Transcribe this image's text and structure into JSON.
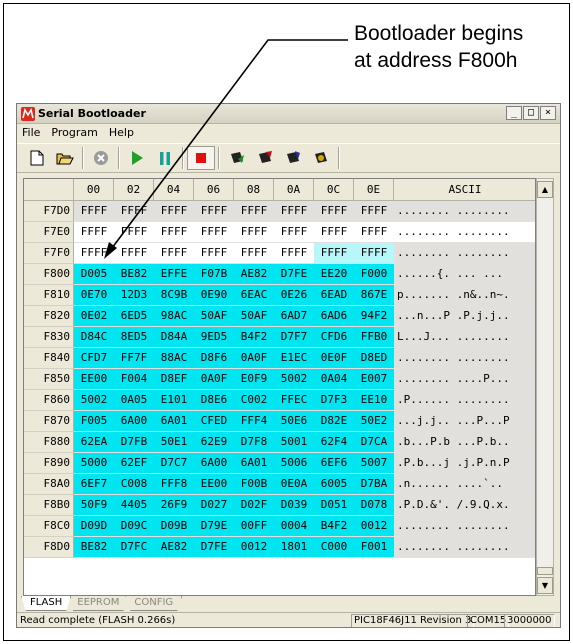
{
  "callout": {
    "line1": "Bootloader begins",
    "line2": "at address F800h"
  },
  "window": {
    "title": "Serial Bootloader",
    "buttons": {
      "minimize": "_",
      "maximize": "□",
      "close": "×"
    }
  },
  "menu": [
    "File",
    "Program",
    "Help"
  ],
  "toolbar": [
    {
      "icon": "new-file-icon",
      "color": "#ffffff"
    },
    {
      "icon": "open-folder-icon",
      "color": "#e8c14a"
    },
    {
      "icon": "abort-icon",
      "color": "#9a9a9a"
    },
    {
      "icon": "run-icon",
      "color": "#1ea02a"
    },
    {
      "icon": "pause-icon",
      "color": "#1a9e9a"
    },
    {
      "icon": "stop-icon",
      "color": "#e01010"
    },
    {
      "icon": "write-chip-icon",
      "color": "#1a8a2a"
    },
    {
      "icon": "read-chip-icon",
      "color": "#c01010"
    },
    {
      "icon": "erase-chip-icon",
      "color": "#2233aa"
    },
    {
      "icon": "verify-chip-icon",
      "color": "#d4aa00"
    }
  ],
  "grid": {
    "headers": [
      "00",
      "02",
      "04",
      "06",
      "08",
      "0A",
      "0C",
      "0E",
      "ASCII"
    ],
    "rows": [
      {
        "addr": "F7D0",
        "cells": [
          "FFFF",
          "FFFF",
          "FFFF",
          "FFFF",
          "FFFF",
          "FFFF",
          "FFFF",
          "FFFF"
        ],
        "ascii": "........ ........",
        "style": "gray"
      },
      {
        "addr": "F7E0",
        "cells": [
          "FFFF",
          "FFFF",
          "FFFF",
          "FFFF",
          "FFFF",
          "FFFF",
          "FFFF",
          "FFFF"
        ],
        "ascii": "........ ........",
        "style": "white"
      },
      {
        "addr": "F7F0",
        "cells": [
          "FFFF",
          "FFFF",
          "FFFF",
          "FFFF",
          "FFFF",
          "FFFF",
          "FFFF",
          "FFFF"
        ],
        "ascii": "........ ........",
        "style": "f7f0"
      },
      {
        "addr": "F800",
        "cells": [
          "D005",
          "BE82",
          "EFFE",
          "F07B",
          "AE82",
          "D7FE",
          "EE20",
          "F000"
        ],
        "ascii": "......{. ... ...",
        "style": "cyan"
      },
      {
        "addr": "F810",
        "cells": [
          "0E70",
          "12D3",
          "8C9B",
          "0E90",
          "6EAC",
          "0E26",
          "6EAD",
          "867E"
        ],
        "ascii": "p....... .n&..n~.",
        "style": "cyan"
      },
      {
        "addr": "F820",
        "cells": [
          "0E02",
          "6ED5",
          "98AC",
          "50AF",
          "50AF",
          "6AD7",
          "6AD6",
          "94F2"
        ],
        "ascii": "...n...P .P.j.j..",
        "style": "cyan"
      },
      {
        "addr": "F830",
        "cells": [
          "D84C",
          "8ED5",
          "D84A",
          "9ED5",
          "B4F2",
          "D7F7",
          "CFD6",
          "FFB0"
        ],
        "ascii": "L...J... ........",
        "style": "cyan"
      },
      {
        "addr": "F840",
        "cells": [
          "CFD7",
          "FF7F",
          "88AC",
          "D8F6",
          "0A0F",
          "E1EC",
          "0E0F",
          "D8ED"
        ],
        "ascii": "........ ........",
        "style": "cyan"
      },
      {
        "addr": "F850",
        "cells": [
          "EE00",
          "F004",
          "D8EF",
          "0A0F",
          "E0F9",
          "5002",
          "0A04",
          "E007"
        ],
        "ascii": "........ ....P...",
        "style": "cyan"
      },
      {
        "addr": "F860",
        "cells": [
          "5002",
          "0A05",
          "E101",
          "D8E6",
          "C002",
          "FFEC",
          "D7F3",
          "EE10"
        ],
        "ascii": ".P...... ........",
        "style": "cyan"
      },
      {
        "addr": "F870",
        "cells": [
          "F005",
          "6A00",
          "6A01",
          "CFED",
          "FFF4",
          "50E6",
          "D82E",
          "50E2"
        ],
        "ascii": "...j.j.. ...P...P",
        "style": "cyan"
      },
      {
        "addr": "F880",
        "cells": [
          "62EA",
          "D7FB",
          "50E1",
          "62E9",
          "D7F8",
          "5001",
          "62F4",
          "D7CA"
        ],
        "ascii": ".b...P.b ...P.b..",
        "style": "cyan"
      },
      {
        "addr": "F890",
        "cells": [
          "5000",
          "62EF",
          "D7C7",
          "6A00",
          "6A01",
          "5006",
          "6EF6",
          "5007"
        ],
        "ascii": ".P.b...j .j.P.n.P",
        "style": "cyan"
      },
      {
        "addr": "F8A0",
        "cells": [
          "6EF7",
          "C008",
          "FFF8",
          "EE00",
          "F00B",
          "0E0A",
          "6005",
          "D7BA"
        ],
        "ascii": ".n...... ....`..",
        "style": "cyan"
      },
      {
        "addr": "F8B0",
        "cells": [
          "50F9",
          "4405",
          "26F9",
          "D027",
          "D02F",
          "D039",
          "D051",
          "D078"
        ],
        "ascii": ".P.D.&'. /.9.Q.x.",
        "style": "cyan"
      },
      {
        "addr": "F8C0",
        "cells": [
          "D09D",
          "D09C",
          "D09B",
          "D79E",
          "00FF",
          "0004",
          "B4F2",
          "0012"
        ],
        "ascii": "........ ........",
        "style": "cyan"
      },
      {
        "addr": "F8D0",
        "cells": [
          "BE82",
          "D7FC",
          "AE82",
          "D7FE",
          "0012",
          "1801",
          "C000",
          "F001"
        ],
        "ascii": "........ ........",
        "style": "cyan"
      }
    ]
  },
  "tabs": [
    "FLASH",
    "EEPROM",
    "CONFIG"
  ],
  "status": {
    "message": "Read complete (FLASH 0.266s)",
    "device": "PIC18F46J11 Revision 3",
    "port": "COM15",
    "baud": "3000000"
  }
}
